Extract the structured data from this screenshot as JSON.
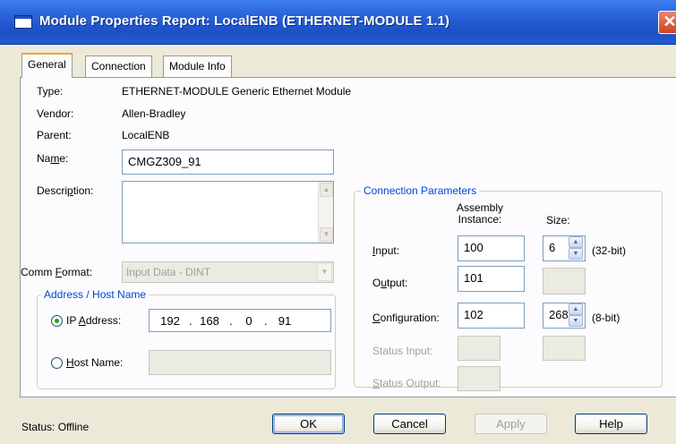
{
  "window": {
    "title": "Module Properties Report: LocalENB (ETHERNET-MODULE 1.1)",
    "close_symbol": "✕"
  },
  "tabs": [
    {
      "label": "General",
      "active": true
    },
    {
      "label": "Connection",
      "active": false
    },
    {
      "label": "Module Info",
      "active": false
    }
  ],
  "general": {
    "type_label": "Type:",
    "type_value": "ETHERNET-MODULE Generic Ethernet Module",
    "vendor_label": "Vendor:",
    "vendor_value": "Allen-Bradley",
    "parent_label": "Parent:",
    "parent_value": "LocalENB",
    "name_label_pre": "Na",
    "name_label_ul": "m",
    "name_label_post": "e:",
    "name_value": "CMGZ309_91",
    "description_label_pre": "Descri",
    "description_label_ul": "p",
    "description_label_post": "tion:",
    "description_value": "",
    "comm_format_label_pre": "Comm ",
    "comm_format_label_ul": "F",
    "comm_format_label_post": "ormat:",
    "comm_format_value": "Input Data - DINT"
  },
  "address": {
    "group_title": "Address / Host Name",
    "ip_option_pre": "IP ",
    "ip_option_ul": "A",
    "ip_option_post": "ddress:",
    "ip_selected": true,
    "ip_octets": [
      "192",
      "168",
      "0",
      "91"
    ],
    "ip_dot": ".",
    "host_option_ul": "H",
    "host_option_post": "ost Name:",
    "host_value": ""
  },
  "connection_params": {
    "group_title": "Connection Parameters",
    "assembly_header_line1": "Assembly",
    "assembly_header_line2": "Instance:",
    "size_header": "Size:",
    "input_label_ul": "I",
    "input_label_post": "nput:",
    "input_instance": "100",
    "input_size": "6",
    "input_unit": "(32-bit)",
    "output_label_pre": "O",
    "output_label_ul": "u",
    "output_label_post": "tput:",
    "output_instance": "101",
    "output_size": "",
    "config_label_ul": "C",
    "config_label_post": "onfiguration:",
    "config_instance": "102",
    "config_size": "268",
    "config_unit": "(8-bit)",
    "status_input_label": "Status Input:",
    "status_output_label_ul": "S",
    "status_output_label_post": "tatus Output:"
  },
  "footer": {
    "status_text": "Status:  Offline",
    "ok_label": "OK",
    "cancel_label": "Cancel",
    "apply_label": "Apply",
    "help_label": "Help"
  },
  "icons": {
    "up_arrow": "▲",
    "down_arrow": "▼"
  }
}
